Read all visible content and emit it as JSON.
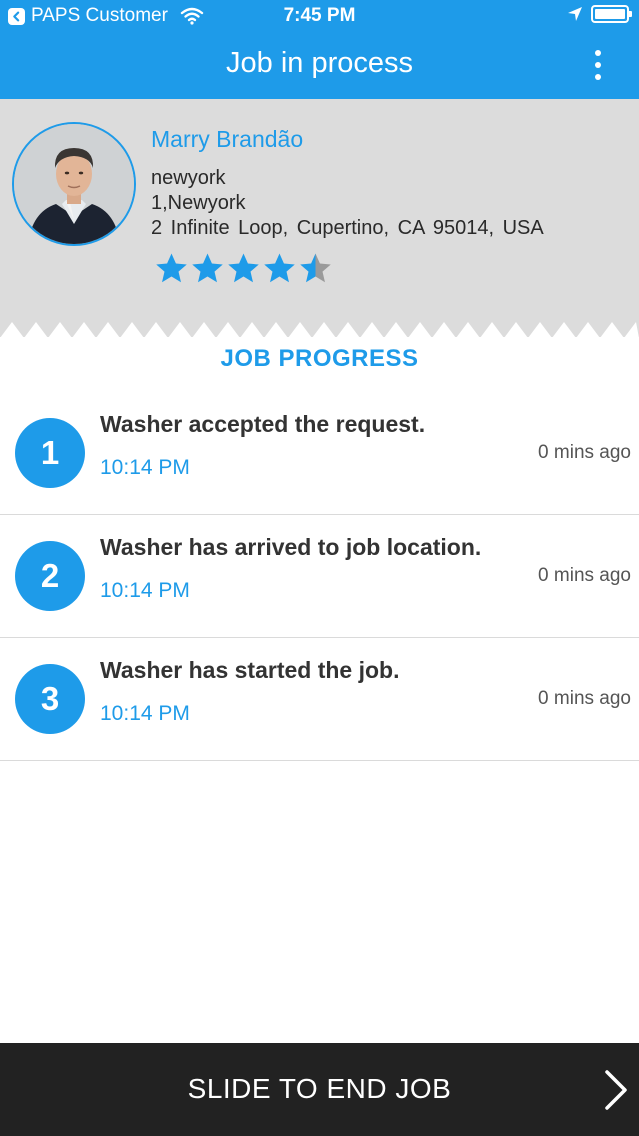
{
  "status_bar": {
    "back_app": "PAPS Customer",
    "time": "7:45 PM",
    "icons": [
      "back-arrow-icon",
      "wifi-icon",
      "location-arrow-icon",
      "battery-icon"
    ]
  },
  "nav": {
    "title": "Job in process",
    "menu_icon": "more-vertical-icon"
  },
  "profile": {
    "name": "Marry Brandão",
    "city": "newyork",
    "address_line1": "1,Newyork",
    "address_line2": "2 Infinite Loop,  Cupertino,  CA 95014,  USA",
    "rating": 4.5,
    "rating_max": 5
  },
  "job_progress": {
    "title": "JOB PROGRESS",
    "steps": [
      {
        "number": "1",
        "text": "Washer accepted the request.",
        "time": "10:14 PM",
        "ago": "0 mins ago"
      },
      {
        "number": "2",
        "text": "Washer has arrived to job location.",
        "time": "10:14 PM",
        "ago": "0 mins ago"
      },
      {
        "number": "3",
        "text": "Washer has started the job.",
        "time": "10:14 PM",
        "ago": "0 mins ago"
      }
    ]
  },
  "slide": {
    "label": "SLIDE TO END JOB",
    "icon": "chevron-right-icon"
  },
  "colors": {
    "accent": "#1e9be9",
    "header_bg": "#1e9be9",
    "profile_bg": "#dcdcdc",
    "slide_bg": "#222222",
    "star_empty": "#9a9a9a"
  }
}
